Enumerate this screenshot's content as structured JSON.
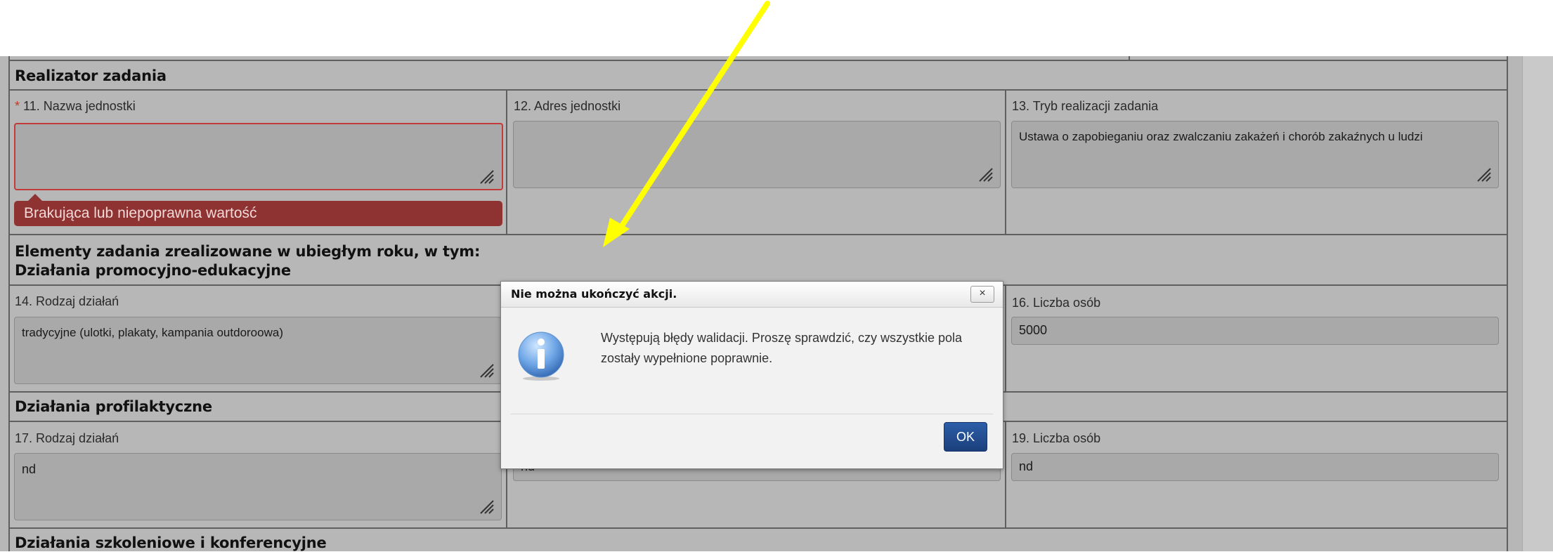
{
  "sections": {
    "realizator_title": "Realizator zadania",
    "elementy_title_line1": "Elementy zadania zrealizowane w ubiegłym roku, w tym:",
    "elementy_title_line2": "Działania promocyjno-edukacyjne",
    "profilaktyczne_title": "Działania profilaktyczne",
    "szkoleniowe_title": "Działania szkoleniowe i konferencyjne"
  },
  "fields": {
    "f11": {
      "required_marker": "*",
      "label": "11. Nazwa jednostki",
      "value": "",
      "error": "Brakująca lub niepoprawna wartość"
    },
    "f12": {
      "label": "12. Adres jednostki",
      "value": ""
    },
    "f13": {
      "label": "13. Tryb realizacji zadania",
      "value": "Ustawa o zapobieganiu oraz zwalczaniu zakażeń i chorób zakaźnych u ludzi"
    },
    "f14": {
      "label": "14. Rodzaj działań",
      "value": "tradycyjne (ulotki, plakaty, kampania outdoroowa)"
    },
    "f16": {
      "label": "16. Liczba osób",
      "value": "5000"
    },
    "f17": {
      "label": "17. Rodzaj działań",
      "value": "nd"
    },
    "f18": {
      "value": "nd"
    },
    "f19": {
      "label": "19. Liczba osób",
      "value": "nd"
    }
  },
  "dialog": {
    "title": "Nie można ukończyć akcji.",
    "close_label": "×",
    "message": "Występują błędy walidacji. Proszę sprawdzić, czy wszystkie pola zostały wypełnione poprawnie.",
    "ok_label": "OK",
    "icon": "info-icon"
  },
  "annotation": {
    "arrow_color": "#ffff00"
  },
  "colors": {
    "error_bubble": "#8e3232",
    "ok_button": "#1f4a8f",
    "field_bg": "#a9a9a9"
  }
}
